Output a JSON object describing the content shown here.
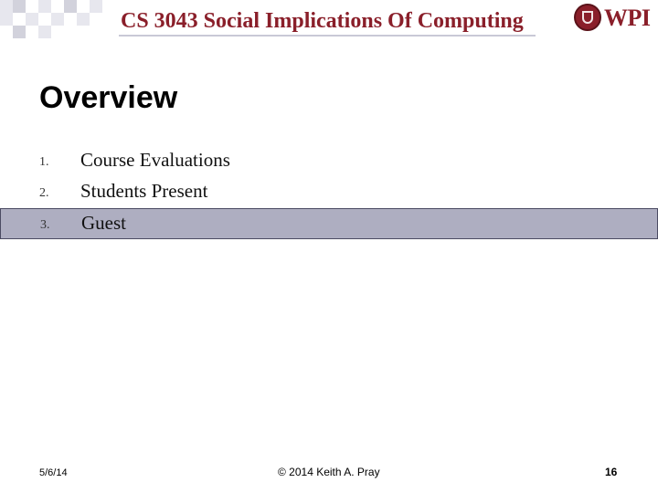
{
  "header": {
    "course_title": "CS 3043 Social Implications Of Computing",
    "logo_text": "WPI"
  },
  "slide": {
    "title": "Overview",
    "agenda": [
      {
        "number": "1.",
        "label": "Course Evaluations",
        "highlighted": false
      },
      {
        "number": "2.",
        "label": "Students Present",
        "highlighted": false
      },
      {
        "number": "3.",
        "label": "Guest",
        "highlighted": true
      }
    ]
  },
  "footer": {
    "date": "5/6/14",
    "copyright": "© 2014 Keith A. Pray",
    "page_number": "16"
  },
  "colors": {
    "header_text": "#8a1f2a",
    "highlight_fill": "#aeaec1",
    "highlight_border": "#4b4b62"
  }
}
